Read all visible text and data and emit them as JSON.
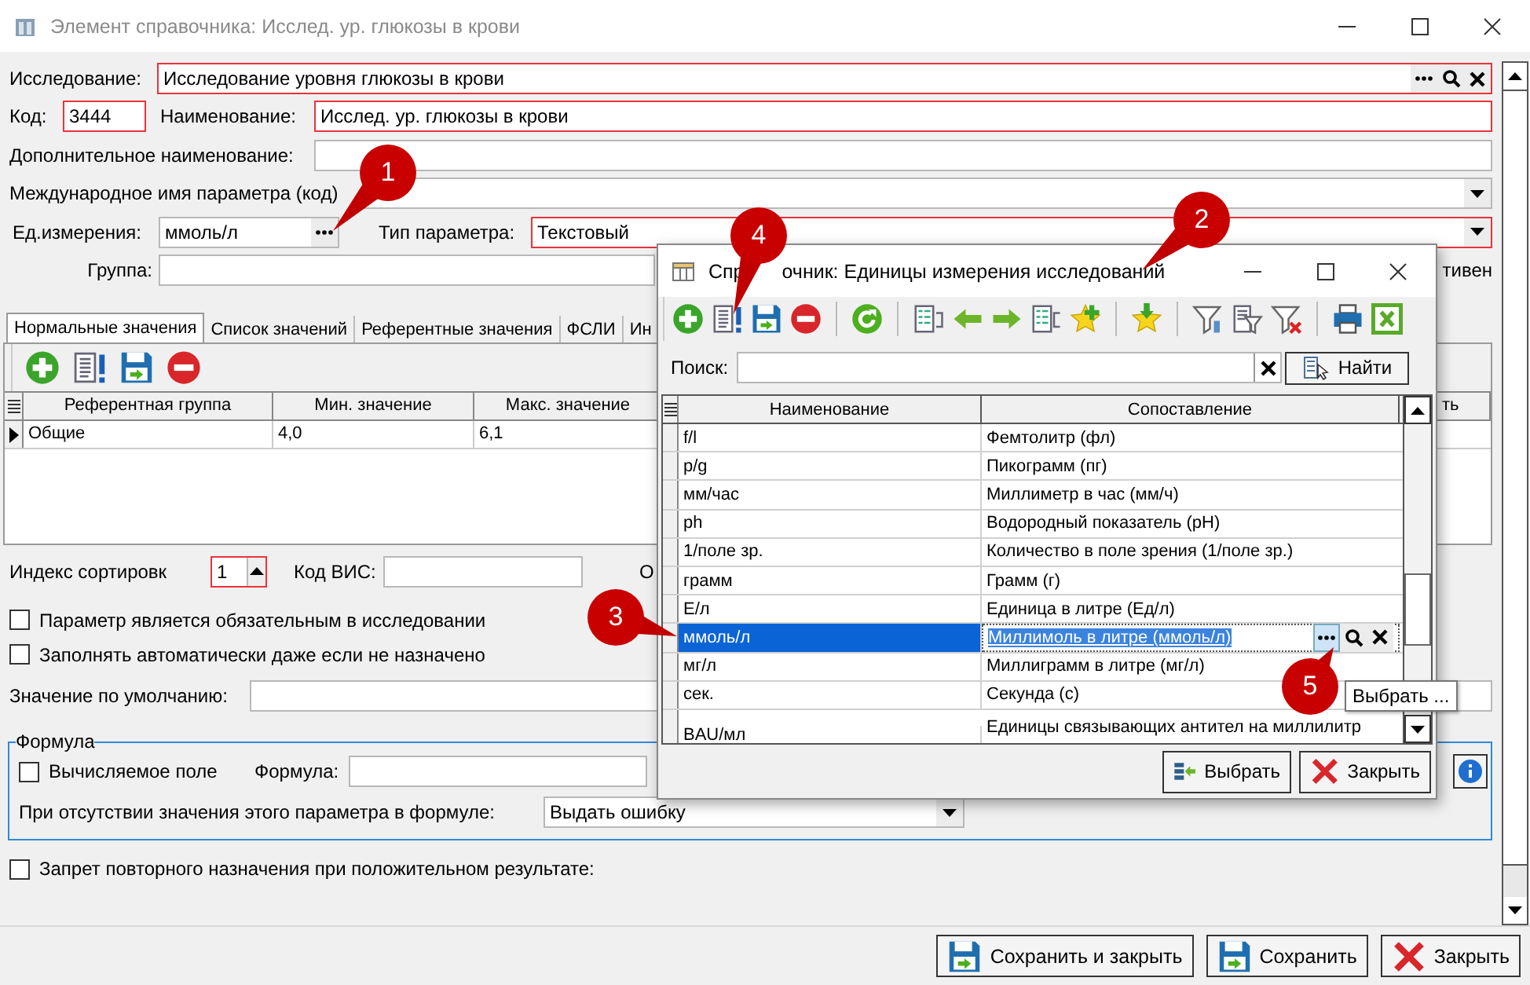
{
  "window": {
    "title": "Элемент справочника: Исслед. ур. глюкозы в крови"
  },
  "study": {
    "label": "Исследование:",
    "value": "Исследование уровня глюкозы в крови",
    "required": true
  },
  "code": {
    "label": "Код:",
    "value": "3444",
    "required": true
  },
  "name": {
    "label": "Наименование:",
    "value": "Исслед. ур. глюкозы в крови",
    "required": true
  },
  "extra_name": {
    "label": "Дополнительное наименование:",
    "required": false
  },
  "intl_name": {
    "label": "Международное имя параметра (код)",
    "required": false
  },
  "unit": {
    "label": "Ед.измерения:",
    "value": "ммоль/л",
    "required": false
  },
  "param_type": {
    "label": "Тип параметра:",
    "value": "Текстовый",
    "required": true
  },
  "group": {
    "label": "Группа:",
    "required": false
  },
  "group_row_label_3": "тивен",
  "tabs": [
    {
      "label": "Нормальные значения",
      "selected": true
    },
    {
      "label": "Список значений",
      "selected": false
    },
    {
      "label": "Референтные значения",
      "selected": false
    },
    {
      "label": "ФСЛИ",
      "selected": false
    },
    {
      "label": "Ин",
      "selected": false
    }
  ],
  "values_table": {
    "columns": [
      "Референтная группа",
      "Мин. значение",
      "Макс. значение",
      "ть"
    ],
    "rows": [
      {
        "cells": [
          "Общие",
          "4,0",
          "6,1"
        ],
        "current": true
      }
    ]
  },
  "sort_index": {
    "label": "Индекс сортировк",
    "value": "1",
    "required": true
  },
  "lis_code": {
    "label": "Код ВИС:",
    "required": false
  },
  "sort_row_label_3": "О",
  "checkboxes": [
    {
      "label": "Параметр является обязательным в исследовании",
      "checked": false
    },
    {
      "label": "Заполнять автоматически даже если не назначено",
      "checked": false
    }
  ],
  "default_value": {
    "label": "Значение по умолчанию:"
  },
  "formula": {
    "title": "Формула",
    "computed": {
      "label": "Вычисляемое поле",
      "checked": false
    },
    "formula_label": "Формула:",
    "missing_label": "При отсутствии значения этого параметра в формуле:",
    "missing_value": "Выдать ошибку"
  },
  "repeat_ban": {
    "label": "Запрет повторного назначения при положительном результате:",
    "checked": false
  },
  "buttons": [
    "Сохранить и закрыть",
    "Сохранить",
    "Закрыть"
  ],
  "dialog": {
    "title_parts": [
      "Спр",
      "очник: Единицы измерения исследований"
    ],
    "search_label": "Поиск:",
    "find_button": "Найти",
    "columns": [
      "Наименование",
      "Сопоставление"
    ],
    "rows": [
      {
        "name": "f/l",
        "mapping": "Фемтолитр (фл)",
        "selected": false
      },
      {
        "name": "p/g",
        "mapping": "Пикограмм (пг)",
        "selected": false
      },
      {
        "name": "мм/час",
        "mapping": "Миллиметр в час (мм/ч)",
        "selected": false
      },
      {
        "name": "ph",
        "mapping": "Водородный показатель (pH)",
        "selected": false
      },
      {
        "name": "1/поле зр.",
        "mapping": "Количество в поле зрения (1/поле зр.)",
        "selected": false
      },
      {
        "name": "грамм",
        "mapping": "Грамм (г)",
        "selected": false
      },
      {
        "name": "Е/л",
        "mapping": "Единица в литре (Ед/л)",
        "selected": false
      },
      {
        "name": "ммоль/л",
        "mapping": "Миллимоль в литре (ммоль/л)",
        "selected": true
      },
      {
        "name": "мг/л",
        "mapping": "Миллиграмм в литре (мг/л)",
        "selected": false
      },
      {
        "name": "сек.",
        "mapping": "Секунда (с)",
        "selected": false
      },
      {
        "name": "BAU/мл",
        "mapping": "Единицы связывающих антител на миллилитр",
        "selected": false
      }
    ],
    "tooltip": "Выбрать ...",
    "buttons": [
      "Выбрать",
      "Закрыть"
    ]
  },
  "callouts": [
    "1",
    "2",
    "3",
    "4",
    "5"
  ]
}
